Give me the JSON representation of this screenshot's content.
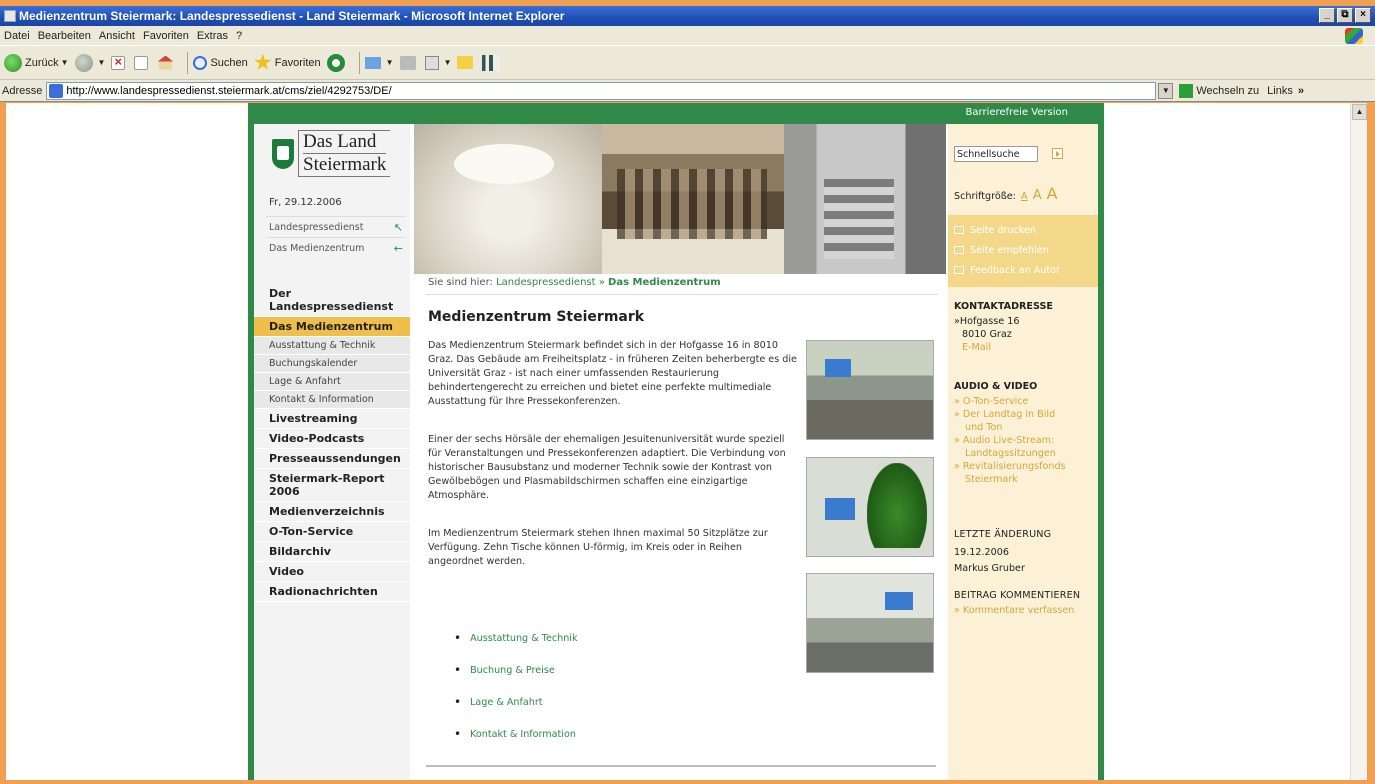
{
  "window": {
    "title": "Medienzentrum Steiermark: Landespressedienst - Land Steiermark - Microsoft Internet Explorer",
    "controls": [
      "_",
      "⧉",
      "×"
    ]
  },
  "menu": [
    "Datei",
    "Bearbeiten",
    "Ansicht",
    "Favoriten",
    "Extras",
    "?"
  ],
  "toolbar": {
    "back": "Zurück",
    "search": "Suchen",
    "favorites": "Favoriten"
  },
  "address": {
    "label": "Adresse",
    "url": "http://www.landespressedienst.steiermark.at/cms/ziel/4292753/DE/",
    "go": "Wechseln zu",
    "links": "Links",
    "chevron": "»"
  },
  "page": {
    "accessible_link": "Barrierefreie Version",
    "logo": {
      "line1": "Das Land",
      "line2": "Steiermark"
    },
    "date": "Fr, 29.12.2006",
    "quick_links": [
      {
        "label": "Landespressedienst",
        "arrow": "↖"
      },
      {
        "label": "Das Medienzentrum",
        "arrow": "←"
      }
    ],
    "nav": {
      "item_landespressedienst": "Der Landespressedienst",
      "item_medienzentrum": "Das Medienzentrum",
      "sub_ausstattung": "Ausstattung & Technik",
      "sub_buchung": "Buchungskalender",
      "sub_lage": "Lage & Anfahrt",
      "sub_kontakt": "Kontakt & Information",
      "item_livestreaming": "Livestreaming",
      "item_video_podcasts": "Video-Podcasts",
      "item_presse": "Presseaussendungen",
      "item_report": "Steiermark-Report 2006",
      "item_medienverzeichnis": "Medienverzeichnis",
      "item_oton": "O-Ton-Service",
      "item_bildarchiv": "Bildarchiv",
      "item_video": "Video",
      "item_radio": "Radionachrichten"
    },
    "breadcrumb": {
      "prefix": "Sie sind hier:",
      "link": "Landespressedienst",
      "separator": "»",
      "current": "Das Medienzentrum"
    },
    "heading": "Medienzentrum Steiermark",
    "paragraphs": [
      "Das Medienzentrum Steiermark befindet sich in der Hofgasse 16 in 8010 Graz. Das Gebäude am Freiheitsplatz - in früheren Zeiten beherbergte es die Universität Graz - ist nach einer umfassenden Restaurierung behindertengerecht zu erreichen und bietet eine perfekte multimediale Ausstattung für Ihre Pressekonferenzen.",
      "Einer der sechs Hörsäle der ehemaligen Jesuitenuniversität wurde speziell für Veranstaltungen und Pressekonferenzen adaptiert. Die Verbindung von historischer Bausubstanz und moderner Technik sowie der Kontrast von Gewölbebögen und Plasmabildschirmen schaffen eine einzigartige Atmosphäre.",
      "Im Medienzentrum Steiermark stehen Ihnen maximal 50 Sitzplätze zur Verfügung. Zehn Tische können U-förmig, im Kreis oder in Reihen angeordnet werden."
    ],
    "bullets": [
      "Ausstattung & Technik",
      "Buchung & Preise",
      "Lage & Anfahrt",
      "Kontakt & Information"
    ],
    "right": {
      "search_value": "Schnellsuche",
      "font_size_label": "Schriftgröße:",
      "font_sizes": [
        "A",
        "A",
        "A"
      ],
      "tools": [
        "Seite drucken",
        "Seite empfehlen",
        "Feedback an Autor"
      ],
      "contact": {
        "heading": "KONTAKTADRESSE",
        "street": "»Hofgasse 16",
        "city": "8010 Graz",
        "email": "E-Mail"
      },
      "audio_video": {
        "heading": "AUDIO & VIDEO",
        "items": [
          "» O-Ton-Service",
          "» Der Landtag in Bild",
          "und Ton",
          "» Audio Live-Stream:",
          "Landtagssitzungen",
          "» Revitalisierungsfonds",
          "Steiermark"
        ]
      },
      "last_change": {
        "heading": "LETZTE ÄNDERUNG",
        "date": "19.12.2006",
        "author": "Markus Gruber"
      },
      "comment": {
        "heading": "BEITRAG KOMMENTIEREN",
        "link": "» Kommentare verfassen"
      }
    }
  },
  "colors": {
    "brand_green": "#2f8a4a",
    "accent_gold": "#f0be4a",
    "right_bg": "#fcf1d6",
    "link_gold": "#d4a83a"
  }
}
